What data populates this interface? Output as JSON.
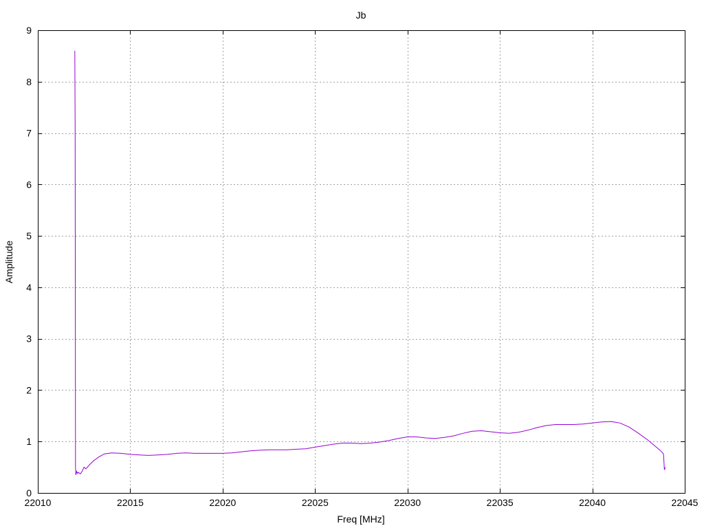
{
  "chart_data": {
    "type": "line",
    "title": "Jb",
    "xlabel": "Freq [MHz]",
    "ylabel": "Amplitude",
    "xlim": [
      22010,
      22045
    ],
    "ylim": [
      0,
      9
    ],
    "xticks": [
      22010,
      22015,
      22020,
      22025,
      22030,
      22035,
      22040,
      22045
    ],
    "yticks": [
      0,
      1,
      2,
      3,
      4,
      5,
      6,
      7,
      8,
      9
    ],
    "grid": true,
    "legend": "none",
    "series": [
      {
        "color": "#9400d3",
        "x": [
          22012.0,
          22012.02,
          22012.04,
          22012.06,
          22012.1,
          22012.15,
          22012.2,
          22012.3,
          22012.4,
          22012.5,
          22012.6,
          22012.8,
          22013.0,
          22013.3,
          22013.6,
          22014.0,
          22014.5,
          22015.0,
          22015.5,
          22016.0,
          22016.5,
          22017.0,
          22017.5,
          22018.0,
          22018.5,
          22019.0,
          22019.5,
          22020.0,
          22020.5,
          22021.0,
          22021.5,
          22022.0,
          22022.5,
          22023.0,
          22023.5,
          22024.0,
          22024.5,
          22025.0,
          22025.5,
          22026.0,
          22026.5,
          22027.0,
          22027.5,
          22028.0,
          22028.5,
          22029.0,
          22029.5,
          22030.0,
          22030.5,
          22031.0,
          22031.5,
          22032.0,
          22032.5,
          22033.0,
          22033.5,
          22034.0,
          22034.5,
          22035.0,
          22035.5,
          22036.0,
          22036.5,
          22037.0,
          22037.5,
          22038.0,
          22038.5,
          22039.0,
          22039.5,
          22040.0,
          22040.5,
          22041.0,
          22041.5,
          22042.0,
          22042.5,
          22043.0,
          22043.3,
          22043.5,
          22043.7,
          22043.8,
          22043.85,
          22043.9,
          22043.95
        ],
        "y": [
          8.6,
          7.05,
          0.5,
          0.35,
          0.42,
          0.38,
          0.4,
          0.37,
          0.42,
          0.5,
          0.47,
          0.55,
          0.62,
          0.7,
          0.76,
          0.78,
          0.77,
          0.75,
          0.74,
          0.73,
          0.74,
          0.75,
          0.77,
          0.78,
          0.77,
          0.77,
          0.77,
          0.77,
          0.78,
          0.8,
          0.82,
          0.83,
          0.84,
          0.84,
          0.84,
          0.85,
          0.86,
          0.89,
          0.92,
          0.95,
          0.97,
          0.97,
          0.96,
          0.97,
          0.99,
          1.02,
          1.06,
          1.09,
          1.09,
          1.07,
          1.06,
          1.08,
          1.11,
          1.16,
          1.2,
          1.21,
          1.19,
          1.17,
          1.16,
          1.18,
          1.22,
          1.27,
          1.31,
          1.33,
          1.33,
          1.33,
          1.34,
          1.36,
          1.38,
          1.39,
          1.36,
          1.28,
          1.16,
          1.03,
          0.94,
          0.88,
          0.82,
          0.78,
          0.76,
          0.45,
          0.5
        ]
      }
    ]
  }
}
